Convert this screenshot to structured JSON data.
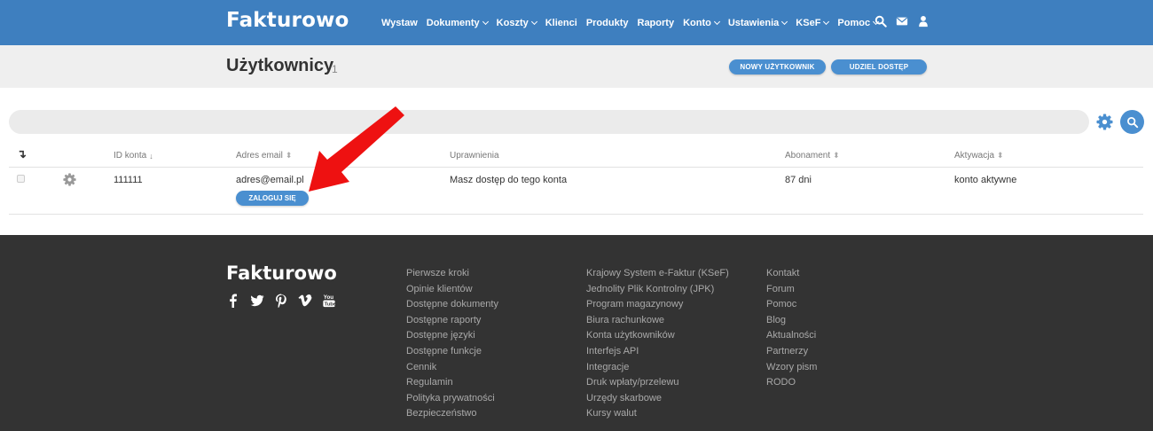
{
  "brand": "Fakturowo",
  "nav": {
    "items": [
      {
        "label": "Wystaw",
        "dropdown": false
      },
      {
        "label": "Dokumenty",
        "dropdown": true
      },
      {
        "label": "Koszty",
        "dropdown": true
      },
      {
        "label": "Klienci",
        "dropdown": false
      },
      {
        "label": "Produkty",
        "dropdown": false
      },
      {
        "label": "Raporty",
        "dropdown": false
      },
      {
        "label": "Konto",
        "dropdown": true
      },
      {
        "label": "Ustawienia",
        "dropdown": true
      },
      {
        "label": "KSeF",
        "dropdown": true
      },
      {
        "label": "Pomoc",
        "dropdown": true
      }
    ],
    "icons": [
      "search-icon",
      "envelope-icon",
      "user-icon"
    ]
  },
  "page": {
    "title": "Użytkownicy",
    "count": "1",
    "new_user_button": "NOWY UŻYTKOWNIK",
    "grant_access_button": "UDZIEL DOSTĘP"
  },
  "search": {
    "value": "",
    "icons": [
      "gear-icon",
      "search-icon"
    ]
  },
  "table": {
    "headers": {
      "select_all": "↴",
      "id": "ID konta",
      "email": "Adres email",
      "permissions": "Uprawnienia",
      "subscription": "Abonament",
      "activation": "Aktywacja"
    },
    "rows": [
      {
        "id": "111111",
        "email": "adres@email.pl",
        "login_button": "ZALOGUJ SIĘ",
        "permissions": "Masz dostęp do tego konta",
        "subscription": "87 dni",
        "activation": "konto aktywne"
      }
    ]
  },
  "footer": {
    "brand": "Fakturowo",
    "socials": [
      "facebook-icon",
      "twitter-icon",
      "pinterest-icon",
      "vimeo-icon",
      "youtube-icon"
    ],
    "col1": [
      "Pierwsze kroki",
      "Opinie klientów",
      "Dostępne dokumenty",
      "Dostępne raporty",
      "Dostępne języki",
      "Dostępne funkcje",
      "Cennik",
      "Regulamin",
      "Polityka prywatności",
      "Bezpieczeństwo"
    ],
    "col2": [
      "Krajowy System e-Faktur (KSeF)",
      "Jednolity Plik Kontrolny (JPK)",
      "Program magazynowy",
      "Biura rachunkowe",
      "Konta użytkowników",
      "Interfejs API",
      "Integracje",
      "Druk wpłaty/przelewu",
      "Urzędy skarbowe",
      "Kursy walut"
    ],
    "col3": [
      "Kontakt",
      "Forum",
      "Pomoc",
      "Blog",
      "Aktualności",
      "Partnerzy",
      "Wzory pism",
      "RODO"
    ]
  },
  "colors": {
    "nav_bg": "#3e7fbf",
    "accent": "#4a8fd0",
    "footer_bg": "#333333",
    "annotation_arrow": "#ee1111"
  }
}
